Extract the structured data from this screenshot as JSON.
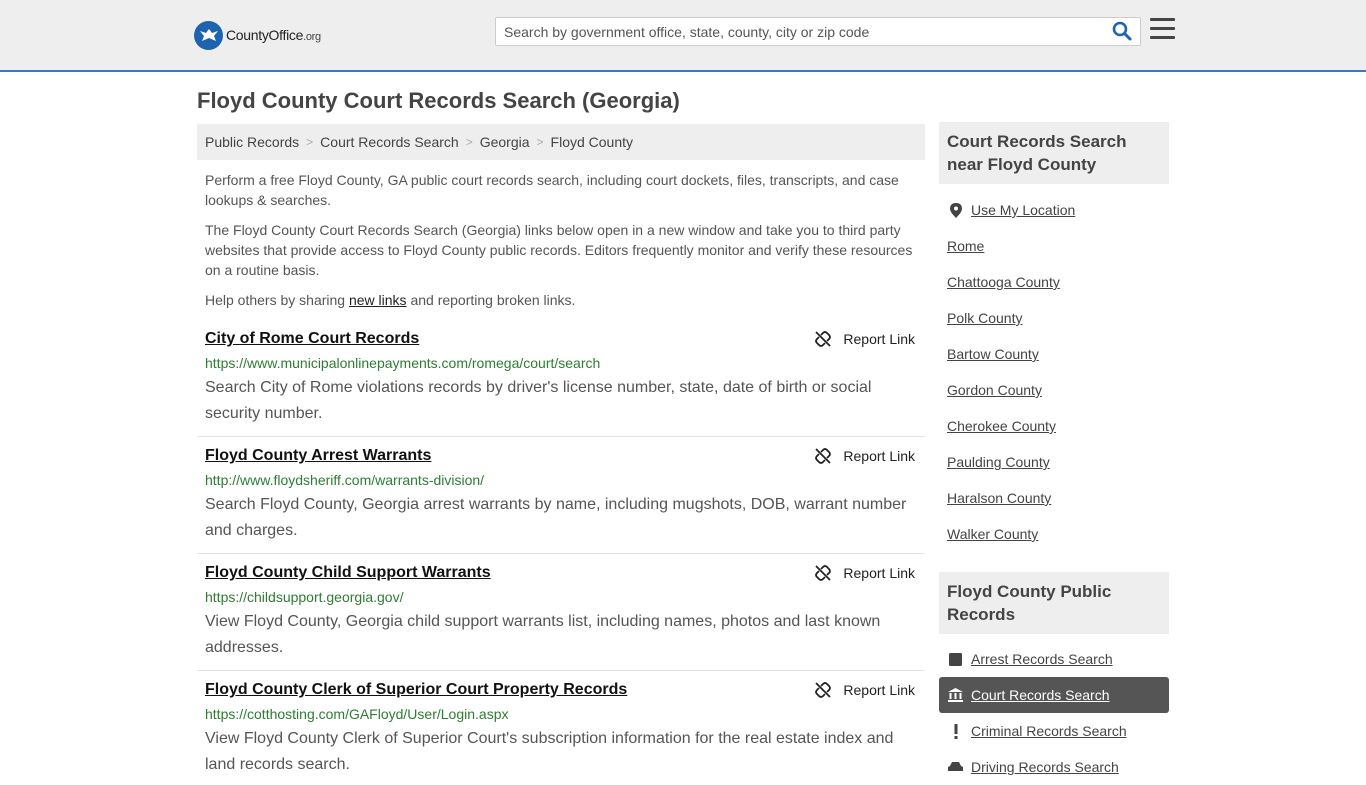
{
  "header": {
    "logo_text_main": "CountyOffice",
    "logo_text_suffix": ".org",
    "search_placeholder": "Search by government office, state, county, city or zip code"
  },
  "page_title": "Floyd County Court Records Search (Georgia)",
  "breadcrumb": [
    "Public Records",
    "Court Records Search",
    "Georgia",
    "Floyd County"
  ],
  "intro": {
    "p1": "Perform a free Floyd County, GA public court records search, including court dockets, files, transcripts, and case lookups & searches.",
    "p2": "The Floyd County Court Records Search (Georgia) links below open in a new window and take you to third party websites that provide access to Floyd County public records. Editors frequently monitor and verify these resources on a routine basis.",
    "p3_before": "Help others by sharing ",
    "p3_link": "new links",
    "p3_after": " and reporting broken links."
  },
  "report_label": "Report Link",
  "results": [
    {
      "title": "City of Rome Court Records",
      "url": "https://www.municipalonlinepayments.com/romega/court/search",
      "desc": "Search City of Rome violations records by driver's license number, state, date of birth or social security number."
    },
    {
      "title": "Floyd County Arrest Warrants",
      "url": "http://www.floydsheriff.com/warrants-division/",
      "desc": "Search Floyd County, Georgia arrest warrants by name, including mugshots, DOB, warrant number and charges."
    },
    {
      "title": "Floyd County Child Support Warrants",
      "url": "https://childsupport.georgia.gov/",
      "desc": "View Floyd County, Georgia child support warrants list, including names, photos and last known addresses."
    },
    {
      "title": "Floyd County Clerk of Superior Court Property Records",
      "url": "https://cotthosting.com/GAFloyd/User/Login.aspx",
      "desc": "View Floyd County Clerk of Superior Court's subscription information for the real estate index and land records search."
    }
  ],
  "sidebar": {
    "nearby_title": "Court Records Search near Floyd County",
    "use_location": "Use My Location",
    "nearby": [
      "Rome",
      "Chattooga County",
      "Polk County",
      "Bartow County",
      "Gordon County",
      "Cherokee County",
      "Paulding County",
      "Haralson County",
      "Walker County"
    ],
    "public_title": "Floyd County Public Records",
    "public_items": [
      {
        "label": "Arrest Records Search",
        "icon": "square-icon"
      },
      {
        "label": "Court Records Search",
        "icon": "courthouse-icon",
        "active": true
      },
      {
        "label": "Criminal Records Search",
        "icon": "exclamation-icon"
      },
      {
        "label": "Driving Records Search",
        "icon": "car-icon"
      }
    ]
  },
  "colors": {
    "accent": "#3478c6",
    "url_green": "#2e7d32",
    "active_bg": "#555555"
  }
}
